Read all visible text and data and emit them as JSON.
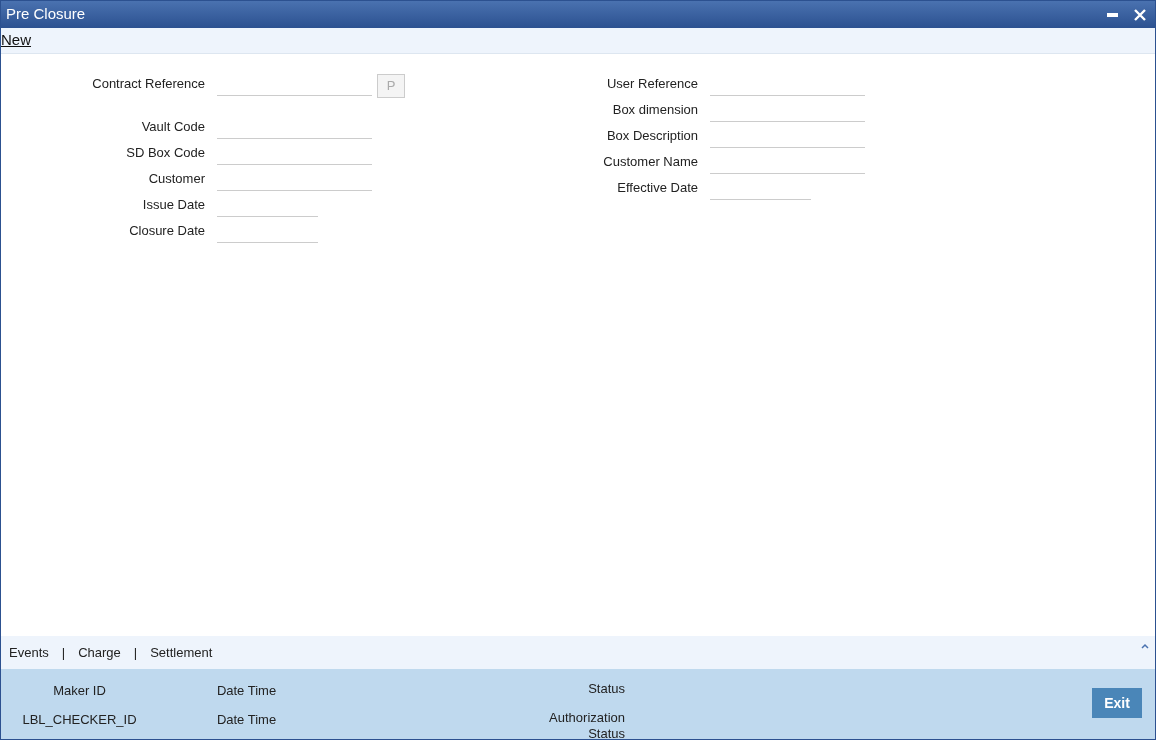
{
  "window": {
    "title": "Pre Closure"
  },
  "toolbar": {
    "new_link": "New"
  },
  "left_fields": [
    {
      "label": "Contract Reference",
      "kind": "text",
      "button": "P"
    },
    {
      "label": "Vault Code",
      "kind": "text"
    },
    {
      "label": "SD Box Code",
      "kind": "text"
    },
    {
      "label": "Customer",
      "kind": "text"
    },
    {
      "label": "Issue Date",
      "kind": "date"
    },
    {
      "label": "Closure Date",
      "kind": "date"
    }
  ],
  "right_fields": [
    {
      "label": "User Reference",
      "kind": "text"
    },
    {
      "label": "Box dimension",
      "kind": "text"
    },
    {
      "label": "Box Description",
      "kind": "text"
    },
    {
      "label": "Customer Name",
      "kind": "text"
    },
    {
      "label": "Effective Date",
      "kind": "date"
    }
  ],
  "tabs": [
    "Events",
    "Charge",
    "Settlement"
  ],
  "tab_separator": "|",
  "audit": [
    {
      "id_label": "Maker ID",
      "time_label": "Date Time",
      "status_label": "Status"
    },
    {
      "id_label": "LBL_CHECKER_ID",
      "time_label": "Date Time",
      "status_label": "Authorization Status"
    }
  ],
  "buttons": [
    "Exit"
  ]
}
